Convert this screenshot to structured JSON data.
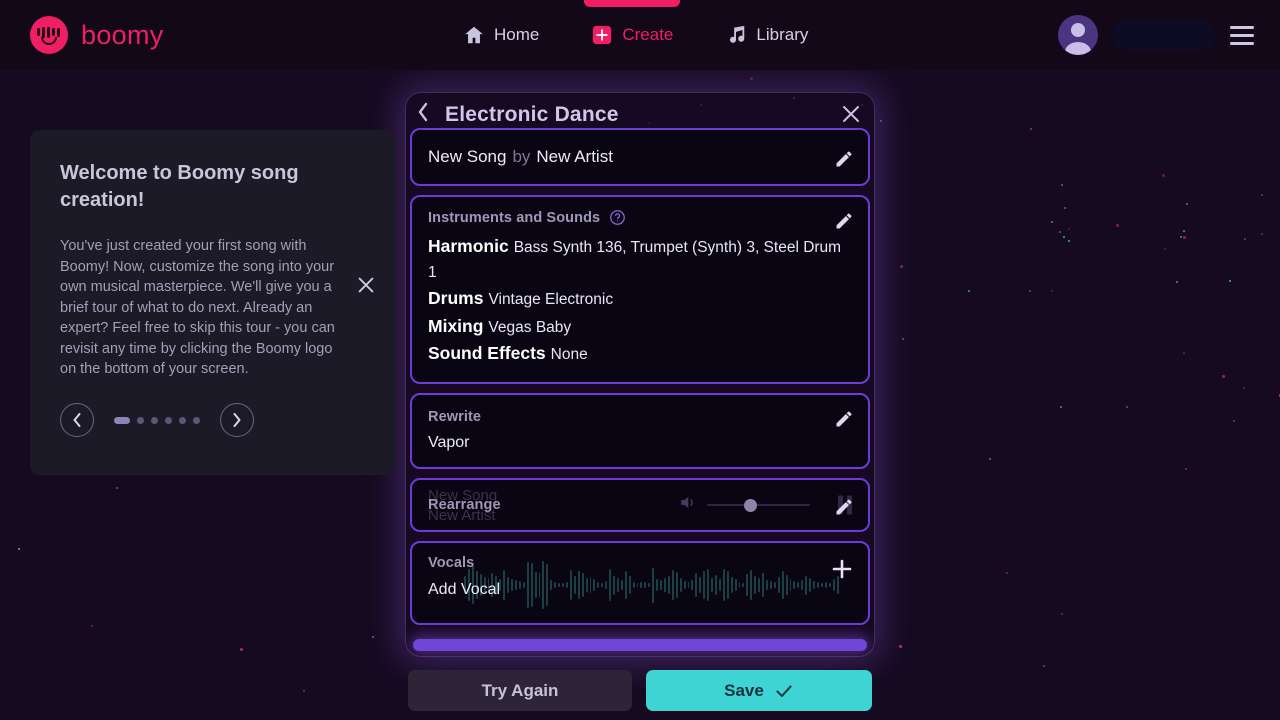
{
  "brand": {
    "name": "boomy",
    "logo_icon": "boomy-smiley-logo",
    "accent": "#F01F63"
  },
  "nav": {
    "items": [
      {
        "label": "Home",
        "icon": "home-icon",
        "active": false
      },
      {
        "label": "Create",
        "icon": "plus-square-icon",
        "active": true
      },
      {
        "label": "Library",
        "icon": "music-note-icon",
        "active": false
      }
    ],
    "avatar_icon": "avatar",
    "menu_icon": "hamburger-menu-icon"
  },
  "tour": {
    "title": "Welcome to Boomy song creation!",
    "body": "You've just created your first song with Boomy! Now, customize the song into your own musical masterpiece. We'll give you a brief tour of what to do next. Already an expert? Feel free to skip this tour - you can revisit any time by clicking the Boomy logo on the bottom of your screen.",
    "close_icon": "close-icon",
    "prev_icon": "chevron-left-icon",
    "next_icon": "chevron-right-icon",
    "steps_total": 6,
    "step_current": 1
  },
  "modal": {
    "title": "Electronic Dance",
    "back_icon": "chevron-left-icon",
    "close_icon": "close-icon",
    "accent_border": "#6E3AD8",
    "song": {
      "title": "New Song",
      "connector": "by",
      "artist": "New Artist",
      "edit_icon": "pencil-icon"
    },
    "instruments": {
      "label": "Instruments and Sounds",
      "help_icon": "help-circle-icon",
      "edit_icon": "pencil-icon",
      "rows": [
        {
          "name": "Harmonic",
          "value": "Bass Synth 136, Trumpet (Synth) 3, Steel Drum 1"
        },
        {
          "name": "Drums",
          "value": "Vintage Electronic"
        },
        {
          "name": "Mixing",
          "value": "Vegas Baby"
        },
        {
          "name": "Sound Effects",
          "value": "None"
        }
      ]
    },
    "rewrite": {
      "label": "Rewrite",
      "value": "Vapor",
      "edit_icon": "pencil-icon"
    },
    "rearrange": {
      "label": "Rearrange",
      "edit_icon": "pencil-icon",
      "ghost_title": "New Song",
      "ghost_artist": "New Artist",
      "volume_icon": "volume-icon",
      "volume_percent": 42,
      "pause_icon": "pause-icon"
    },
    "vocals": {
      "label": "Vocals",
      "value": "Add Vocal",
      "add_icon": "plus-icon",
      "waveform_color": "#1E4B4B"
    }
  },
  "footer": {
    "try_again_label": "Try Again",
    "save_label": "Save",
    "save_icon": "check-icon",
    "save_color": "#3ED4D4"
  }
}
